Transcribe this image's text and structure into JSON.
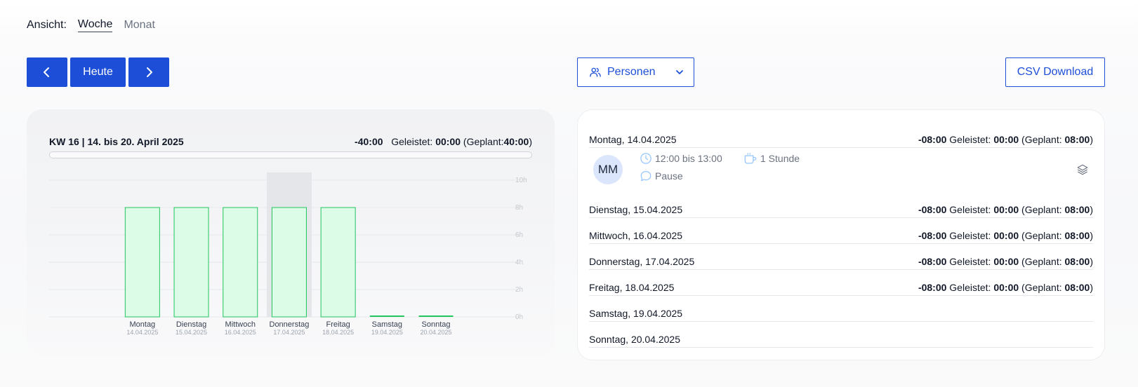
{
  "view": {
    "label": "Ansicht:",
    "options": [
      "Woche",
      "Monat"
    ],
    "active": "Woche"
  },
  "toolbar": {
    "prev_icon": "chevron-left-icon",
    "today_label": "Heute",
    "next_icon": "chevron-right-icon",
    "persons_label": "Personen",
    "persons_icon": "users-icon",
    "csv_label": "CSV Download"
  },
  "summary": {
    "title": "KW 16 | 14. bis 20. April 2025",
    "balance": "-40:00",
    "done_label": "Geleistet:",
    "done": "00:00",
    "planned_label": "(Geplant:",
    "planned": "40:00",
    "planned_close": ")",
    "progress": 0
  },
  "chart_data": {
    "type": "bar",
    "categories": [
      "Montag",
      "Dienstag",
      "Mittwoch",
      "Donnerstag",
      "Freitag",
      "Samstag",
      "Sonntag"
    ],
    "dates": [
      "14.04.2025",
      "15.04.2025",
      "16.04.2025",
      "17.04.2025",
      "18.04.2025",
      "19.04.2025",
      "20.04.2025"
    ],
    "series": [
      {
        "values": [
          8,
          8,
          8,
          8,
          8,
          0,
          0
        ]
      }
    ],
    "highlighted_category": "Donnerstag",
    "y_ticks": [
      "0h",
      "2h",
      "4h",
      "6h",
      "8h",
      "10h"
    ],
    "ylim": [
      0,
      10
    ],
    "grid": true,
    "colors": {
      "bar_fill": "#dcfce7",
      "bar_stroke": "#22c55e",
      "highlight": "#e5e6e9"
    }
  },
  "days": [
    {
      "name": "Montag, 14.04.2025",
      "balance": "-08:00",
      "done_label": "Geleistet:",
      "done": "00:00",
      "planned_label": "(Geplant:",
      "planned": "08:00",
      "close": ")"
    },
    {
      "name": "Dienstag, 15.04.2025",
      "balance": "-08:00",
      "done_label": "Geleistet:",
      "done": "00:00",
      "planned_label": "(Geplant:",
      "planned": "08:00",
      "close": ")"
    },
    {
      "name": "Mittwoch, 16.04.2025",
      "balance": "-08:00",
      "done_label": "Geleistet:",
      "done": "00:00",
      "planned_label": "(Geplant:",
      "planned": "08:00",
      "close": ")"
    },
    {
      "name": "Donnerstag, 17.04.2025",
      "balance": "-08:00",
      "done_label": "Geleistet:",
      "done": "00:00",
      "planned_label": "(Geplant:",
      "planned": "08:00",
      "close": ")"
    },
    {
      "name": "Freitag, 18.04.2025",
      "balance": "-08:00",
      "done_label": "Geleistet:",
      "done": "00:00",
      "planned_label": "(Geplant:",
      "planned": "08:00",
      "close": ")"
    },
    {
      "name": "Samstag, 19.04.2025"
    },
    {
      "name": "Sonntag, 20.04.2025"
    }
  ],
  "entry": {
    "initials": "MM",
    "time": "12:00 bis 13:00",
    "break": "1 Stunde",
    "note": "Pause",
    "icons": [
      "clock-icon",
      "coffee-icon",
      "comment-icon",
      "layers-icon"
    ]
  },
  "colors": {
    "primary": "#1d4ed8",
    "avatar_bg": "#dbe5fb",
    "icon_blue": "#93c5fd"
  }
}
